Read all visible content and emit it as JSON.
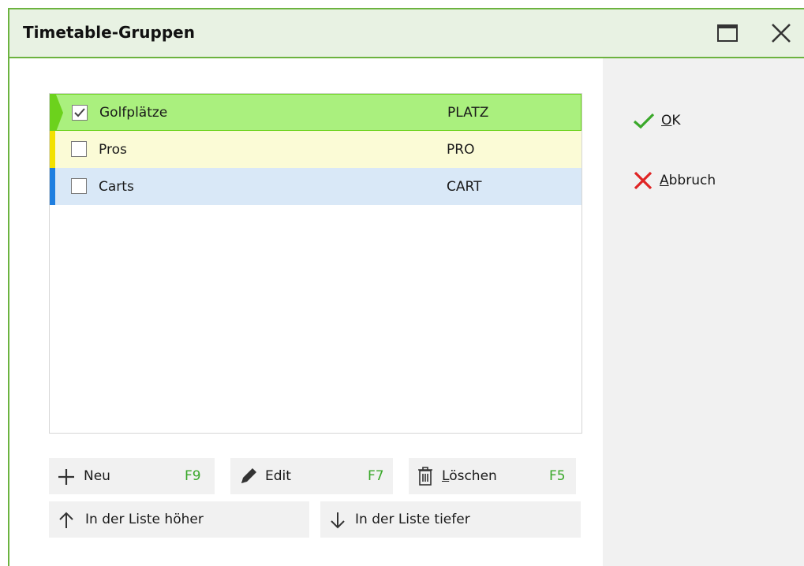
{
  "window": {
    "title": "Timetable-Gruppen"
  },
  "list": {
    "rows": [
      {
        "name": "Golfplätze",
        "code": "PLATZ",
        "checked": true,
        "marker_color": "#6cd21c",
        "bg": "#aaf07e"
      },
      {
        "name": "Pros",
        "code": "PRO",
        "checked": false,
        "marker_color": "#f2e100",
        "bg": "#fbfbd6"
      },
      {
        "name": "Carts",
        "code": "CART",
        "checked": false,
        "marker_color": "#1f7fe0",
        "bg": "#d9e8f7"
      }
    ]
  },
  "side": {
    "ok": {
      "accel": "O",
      "rest": "K",
      "icon": "check-icon"
    },
    "cancel": {
      "accel": "A",
      "rest": "bbruch",
      "icon": "x-icon"
    }
  },
  "buttons": {
    "new": {
      "label": "Neu",
      "key": "F9",
      "icon": "plus-icon"
    },
    "edit": {
      "label": "Edit",
      "key": "F7",
      "icon": "pencil-icon"
    },
    "delete": {
      "accel": "L",
      "rest": "öschen",
      "key": "F5",
      "icon": "trash-icon"
    },
    "up": {
      "label": "In der Liste höher",
      "icon": "arrow-up-icon"
    },
    "down": {
      "label": "In der Liste tiefer",
      "icon": "arrow-down-icon"
    }
  },
  "colors": {
    "accent": "#6cb33f",
    "key": "#3aa82a",
    "ok": "#3aa82a",
    "cancel": "#e02424"
  }
}
